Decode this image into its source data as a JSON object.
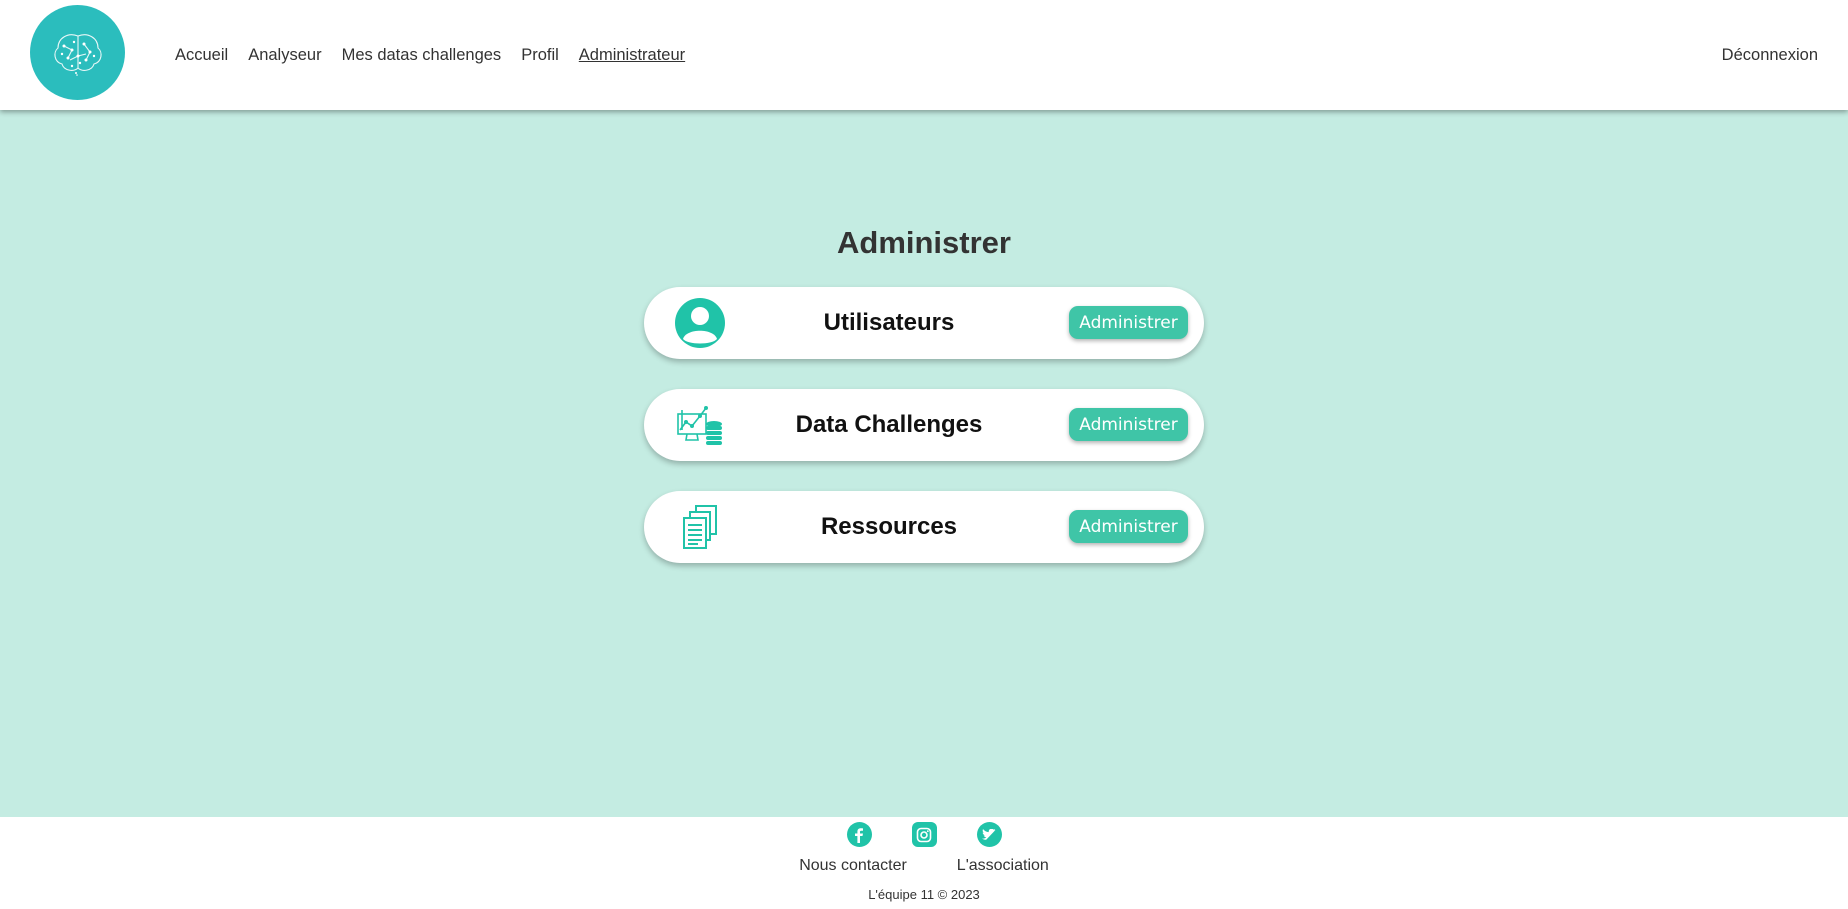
{
  "nav": {
    "items": [
      {
        "label": "Accueil"
      },
      {
        "label": "Analyseur"
      },
      {
        "label": "Mes datas challenges"
      },
      {
        "label": "Profil"
      },
      {
        "label": "Administrateur"
      }
    ],
    "active_index": 4,
    "logout_label": "Déconnexion",
    "logo_icon": "brain-icon"
  },
  "main": {
    "title": "Administrer",
    "cards": [
      {
        "label": "Utilisateurs",
        "icon": "user-icon",
        "button_label": "Administrer"
      },
      {
        "label": "Data Challenges",
        "icon": "data-analytics-icon",
        "button_label": "Administrer"
      },
      {
        "label": "Ressources",
        "icon": "documents-icon",
        "button_label": "Administrer"
      }
    ]
  },
  "footer": {
    "socials": [
      "facebook-icon",
      "instagram-icon",
      "twitter-icon"
    ],
    "links": [
      "Nous contacter",
      "L'association"
    ],
    "copyright": "L'équipe 11 © 2023"
  },
  "colors": {
    "background": "#c4ece2",
    "accent": "#3fc5a7",
    "icon": "#20c3a8",
    "logo": "#2bbdbd"
  }
}
